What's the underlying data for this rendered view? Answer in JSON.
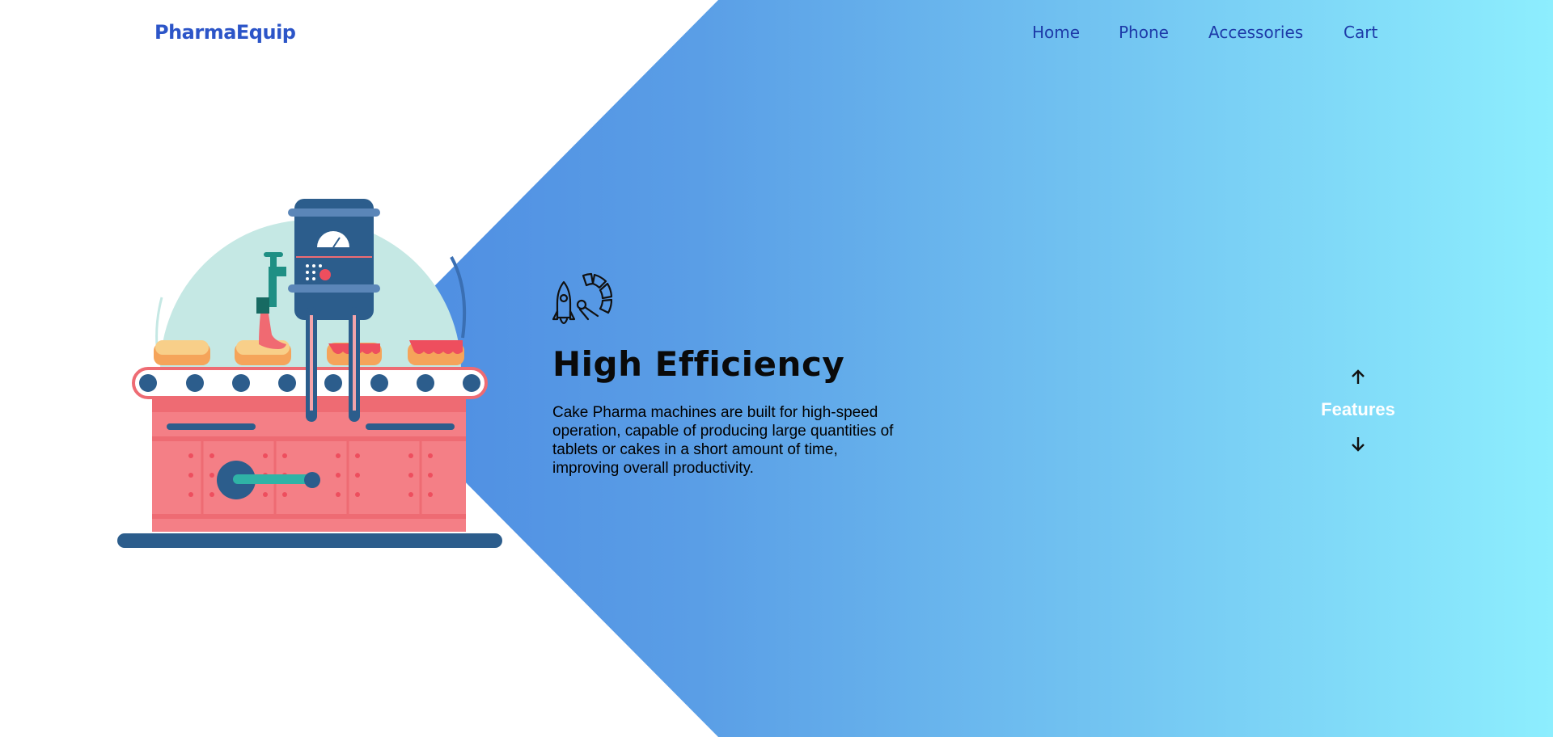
{
  "header": {
    "logo": "PharmaEquip",
    "nav": [
      {
        "label": "Home"
      },
      {
        "label": "Phone"
      },
      {
        "label": "Accessories"
      },
      {
        "label": "Cart"
      }
    ]
  },
  "feature": {
    "icon": "rocket-speedometer-icon",
    "title": "High Efficiency",
    "description": "Cake Pharma machines are built for high-speed operation, capable of producing large quantities of tablets or cakes in a short amount of time, improving overall productivity."
  },
  "side_nav": {
    "label": "Features",
    "up_icon": "arrow-up-icon",
    "down_icon": "arrow-down-icon"
  },
  "colors": {
    "gradient_start": "#3f77dc",
    "gradient_end": "#8deefe",
    "logo": "#2c55c8",
    "nav": "#1d3aa8"
  }
}
